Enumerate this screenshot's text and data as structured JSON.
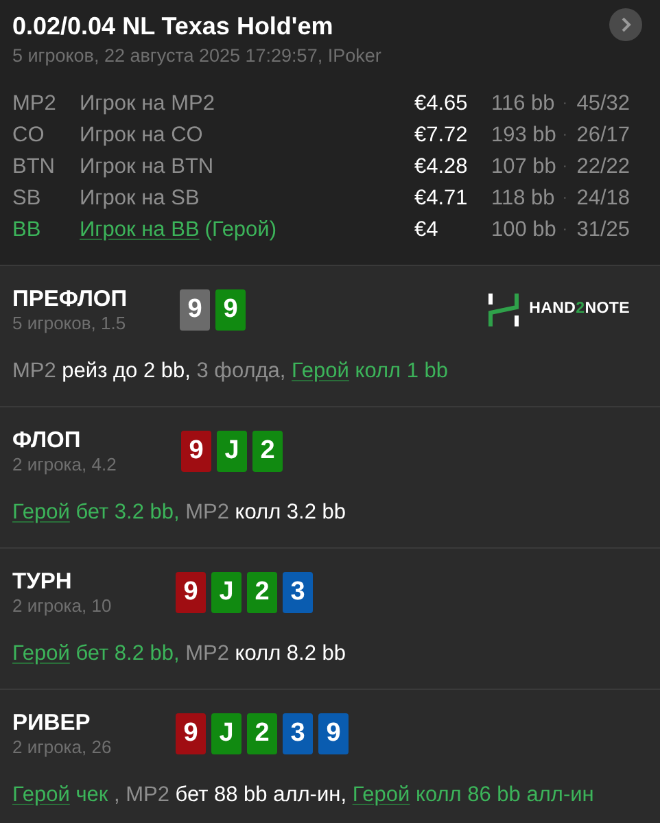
{
  "header": {
    "title": "0.02/0.04 NL Texas Hold'em",
    "subtitle": "5 игроков, 22 августа 2025 17:29:57, IPoker"
  },
  "players": [
    {
      "position": "MP2",
      "name": "Игрок на MP2",
      "hero": false,
      "stack": "€4.65",
      "bb": "116 bb",
      "separator": "·",
      "stats": "45/32"
    },
    {
      "position": "CO",
      "name": "Игрок на CO",
      "hero": false,
      "stack": "€7.72",
      "bb": "193 bb",
      "separator": "·",
      "stats": "26/17"
    },
    {
      "position": "BTN",
      "name": "Игрок на BTN",
      "hero": false,
      "stack": "€4.28",
      "bb": "107 bb",
      "separator": "·",
      "stats": "22/22"
    },
    {
      "position": "SB",
      "name": "Игрок на SB",
      "hero": false,
      "stack": "€4.71",
      "bb": "118 bb",
      "separator": "·",
      "stats": "24/18"
    },
    {
      "position": "BB",
      "name": "Игрок на BB",
      "hero": true,
      "hero_label": "(Герой)",
      "stack": "€4",
      "bb": "100 bb",
      "separator": "·",
      "stats": "31/25"
    }
  ],
  "streets": [
    {
      "title": "ПРЕФЛОП",
      "info": "5 игроков, 1.5",
      "logo": {
        "parts": [
          {
            "text": "HAND",
            "accent": false
          },
          {
            "text": "2",
            "accent": true
          },
          {
            "text": "NOTE",
            "accent": false
          }
        ]
      },
      "cards": [
        {
          "rank": "9",
          "color": "#6b6b6b"
        },
        {
          "rank": "9",
          "color": "#118a11"
        }
      ],
      "actions": [
        {
          "kind": "name",
          "text": "MP2"
        },
        {
          "kind": "act",
          "text": " рейз до 2 bb,"
        },
        {
          "kind": "name",
          "text": " 3 фолда, "
        },
        {
          "kind": "hero_name",
          "text": "Герой"
        },
        {
          "kind": "hero_act",
          "text": " колл 1 bb"
        }
      ]
    },
    {
      "title": "ФЛОП",
      "info": "2 игрока, 4.2",
      "cards": [
        {
          "rank": "9",
          "color": "#a00d12"
        },
        {
          "rank": "J",
          "color": "#118a11"
        },
        {
          "rank": "2",
          "color": "#118a11"
        }
      ],
      "actions": [
        {
          "kind": "hero_name",
          "text": "Герой"
        },
        {
          "kind": "hero_act",
          "text": " бет 3.2 bb,"
        },
        {
          "kind": "name",
          "text": " MP2"
        },
        {
          "kind": "act",
          "text": " колл 3.2 bb"
        }
      ]
    },
    {
      "title": "ТУРН",
      "info": "2 игрока, 10",
      "cards": [
        {
          "rank": "9",
          "color": "#a00d12"
        },
        {
          "rank": "J",
          "color": "#118a11"
        },
        {
          "rank": "2",
          "color": "#118a11"
        },
        {
          "rank": "3",
          "color": "#0a5cb0"
        }
      ],
      "actions": [
        {
          "kind": "hero_name",
          "text": "Герой"
        },
        {
          "kind": "hero_act",
          "text": " бет 8.2 bb,"
        },
        {
          "kind": "name",
          "text": " MP2"
        },
        {
          "kind": "act",
          "text": " колл 8.2 bb"
        }
      ]
    },
    {
      "title": "РИВЕР",
      "info": "2 игрока, 26",
      "cards": [
        {
          "rank": "9",
          "color": "#a00d12"
        },
        {
          "rank": "J",
          "color": "#118a11"
        },
        {
          "rank": "2",
          "color": "#118a11"
        },
        {
          "rank": "3",
          "color": "#0a5cb0"
        },
        {
          "rank": "9",
          "color": "#0a5cb0"
        }
      ],
      "actions": [
        {
          "kind": "hero_name",
          "text": "Герой"
        },
        {
          "kind": "hero_act",
          "text": " чек"
        },
        {
          "kind": "name",
          "text": " , MP2"
        },
        {
          "kind": "act",
          "text": " бет 88 bb алл-ин, "
        },
        {
          "kind": "hero_name",
          "text": "Герой"
        },
        {
          "kind": "hero_act",
          "text": " колл 86 bb алл-ин"
        }
      ]
    }
  ]
}
